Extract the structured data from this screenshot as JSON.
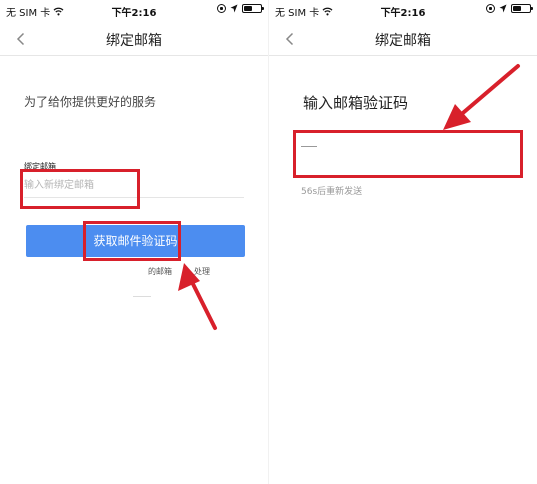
{
  "status_bar": {
    "carrier": "无 SIM 卡",
    "time": "下午2:16"
  },
  "step1": {
    "nav_title": "绑定邮箱",
    "intro": "为了给你提供更好的服务",
    "field_label": "绑定邮箱",
    "email_placeholder": "输入新绑定邮箱",
    "email_value": "",
    "get_code_button": "获取邮件验证码",
    "help_text": "的邮箱",
    "help_text_tail": "处理"
  },
  "step2": {
    "nav_title": "绑定邮箱",
    "code_title": "输入邮箱验证码",
    "code_value": "",
    "resend": "56s后重新发送"
  },
  "colors": {
    "primary": "#4c8df0",
    "annotation": "#d8202b"
  }
}
